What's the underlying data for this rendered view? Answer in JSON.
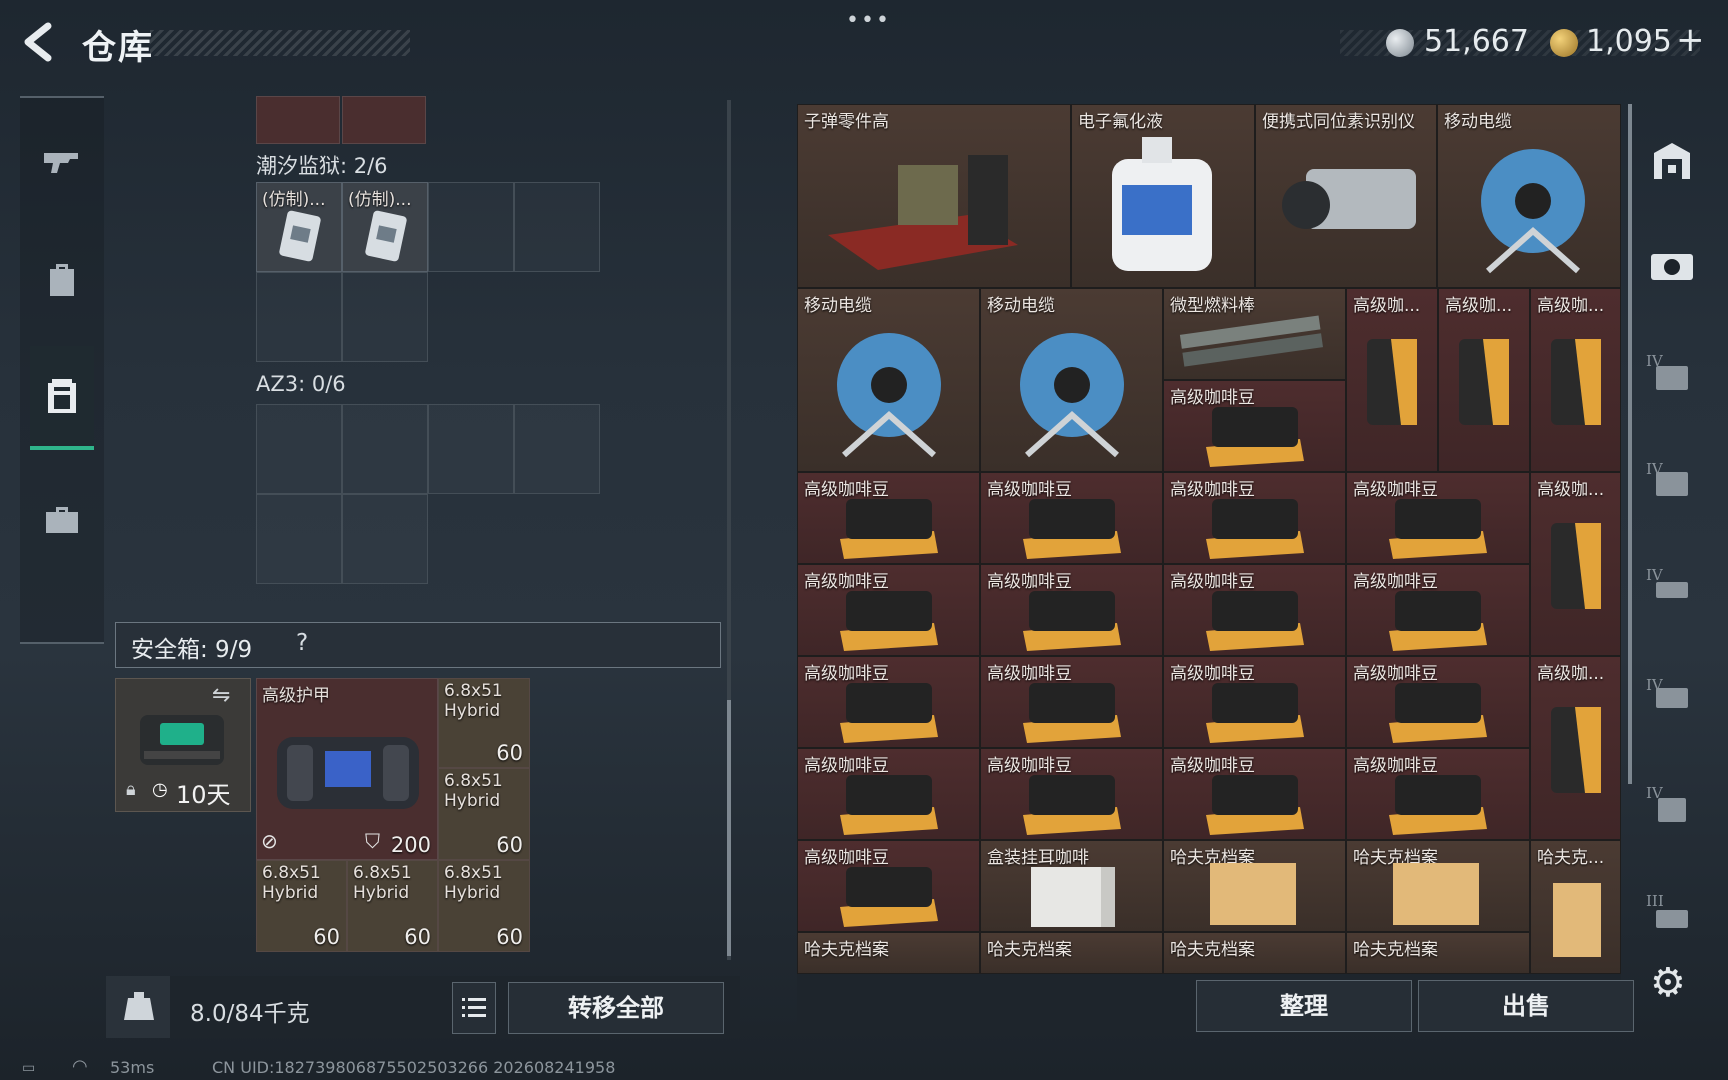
{
  "header": {
    "title": "仓库",
    "currency_1": "51,667",
    "currency_2": "1,095",
    "plus": "+"
  },
  "nav": {
    "items": [
      "gun-icon",
      "backpack-icon",
      "vest-icon",
      "briefcase-icon"
    ],
    "active_index": 2
  },
  "containers": {
    "top_cells_count": 2,
    "group1_label": "潮汐监狱: 2/6",
    "group1_items": [
      {
        "name": "(仿制)..."
      },
      {
        "name": "(仿制)..."
      }
    ],
    "group2_label": "AZ3: 0/6",
    "safebox_label": "安全箱: 9/9",
    "safebox_help": "?",
    "safebox_timer": "10天",
    "armor_name": "高级护甲",
    "armor_value": "200",
    "ammo": [
      {
        "name": "6.8x51 Hybrid",
        "count": "60"
      },
      {
        "name": "6.8x51 Hybrid",
        "count": "60"
      },
      {
        "name": "6.8x51 Hybrid",
        "count": "60"
      },
      {
        "name": "6.8x51 Hybrid",
        "count": "60"
      },
      {
        "name": "6.8x51 Hybrid",
        "count": "60"
      }
    ]
  },
  "footer": {
    "weight": "8.0/84千克",
    "transfer_all": "转移全部",
    "sort": "整理",
    "sell": "出售"
  },
  "stash": {
    "row1": [
      "子弹零件高",
      "电子氟化液",
      "便携式同位素识别仪",
      "移动电缆"
    ],
    "row2": [
      "移动电缆",
      "移动电缆",
      "微型燃料棒",
      "高级咖...",
      "高级咖...",
      "高级咖..."
    ],
    "coffee": "高级咖啡豆",
    "coffee_short": "高级咖...",
    "boxed_coffee": "盒装挂耳咖啡",
    "archive": "哈夫克档案",
    "archive_short": "哈夫克..."
  },
  "right_nav": {
    "tiers": [
      "IV",
      "IV",
      "IV",
      "IV",
      "IV",
      "III"
    ]
  },
  "status": {
    "ping": "53ms",
    "uid": "CN UID:182739806875502503266 202608241958"
  },
  "colors": {
    "accent": "#2fb58b",
    "red_cell": "#4e2d2e",
    "brown_cell": "#4b3b33"
  }
}
